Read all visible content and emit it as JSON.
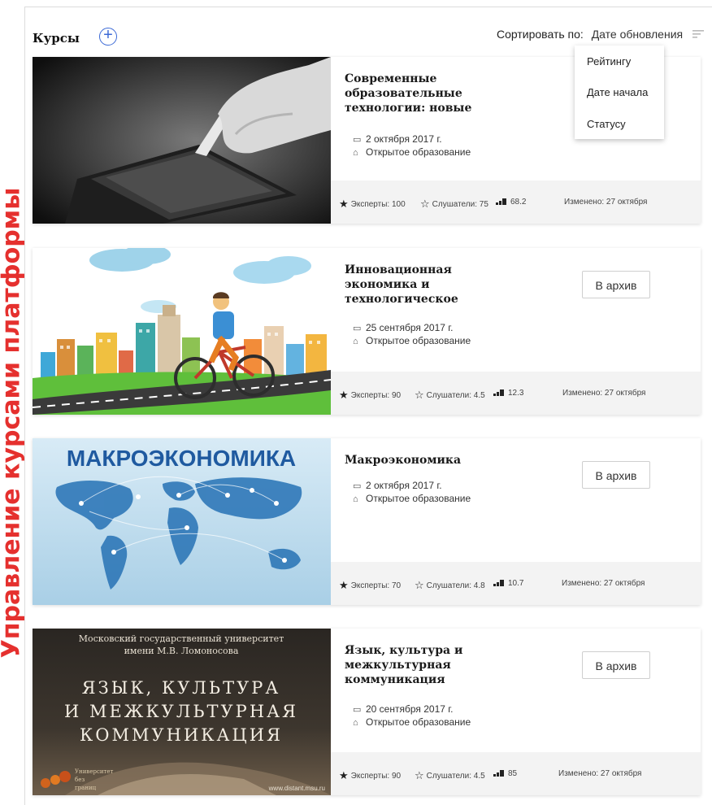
{
  "side_label": "Управление курсами платформы",
  "header": {
    "title": "Курсы",
    "add_icon": "plus-circle-icon",
    "sort_label": "Сортировать по:",
    "sort_value": "Дате обновления",
    "sort_icon": "sort-lines-icon"
  },
  "sort_dropdown": {
    "options": [
      "Рейтингу",
      "Дате начала",
      "Статусу"
    ]
  },
  "courses": [
    {
      "title": "Современные образовательные технологии: новые",
      "date": "2 октября 2017 г.",
      "org": "Открытое образование",
      "experts": "Эксперты: 100",
      "listeners": "Слушатели: 75",
      "rating": "68.2",
      "changed": "Изменено: 27 октября",
      "archive_label": ""
    },
    {
      "title": "Инновационная экономика и технологическое",
      "date": "25 сентября 2017 г.",
      "org": "Открытое образование",
      "experts": "Эксперты: 90",
      "listeners": "Слушатели: 4.5",
      "rating": "12.3",
      "changed": "Изменено: 27 октября",
      "archive_label": "В архив"
    },
    {
      "title": "Макроэкономика",
      "image_text": "МАКРОЭКОНОМИКА",
      "date": "2 октября 2017 г.",
      "org": "Открытое образование",
      "experts": "Эксперты: 70",
      "listeners": "Слушатели: 4.8",
      "rating": "10.7",
      "changed": "Изменено: 27 октября",
      "archive_label": "В архив"
    },
    {
      "title": "Язык, культура и межкультурная коммуникация",
      "image_text": {
        "line1": "Московский государственный университет",
        "line2": "имени М.В. Ломоносова",
        "big1": "ЯЗЫК, КУЛЬТУРА",
        "big2": "И МЕЖКУЛЬТУРНАЯ",
        "big3": "КОММУНИКАЦИЯ",
        "logo": "Университет без границ",
        "url": "www.distant.msu.ru"
      },
      "date": "20 сентября 2017 г.",
      "org": "Открытое образование",
      "experts": "Эксперты: 90",
      "listeners": "Слушатели: 4.5",
      "rating": "85",
      "changed": "Изменено: 27 октября",
      "archive_label": "В архив"
    }
  ],
  "colors": {
    "accent": "#3c6ad6",
    "side_label": "#e5302e",
    "footer_bg": "#f3f3f3"
  }
}
